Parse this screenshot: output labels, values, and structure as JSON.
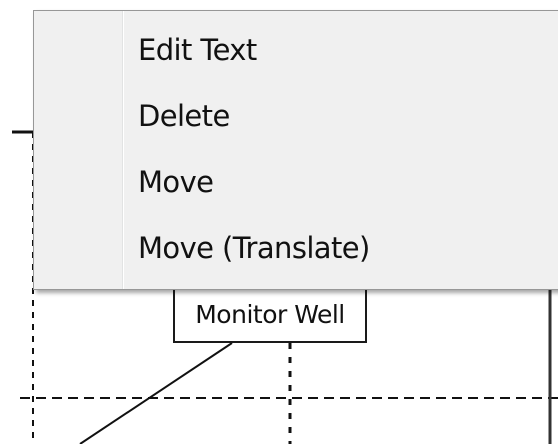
{
  "context_menu": {
    "items": [
      {
        "label": "Edit Text"
      },
      {
        "label": "Delete"
      },
      {
        "label": "Move"
      },
      {
        "label": "Move (Translate)"
      }
    ]
  },
  "map": {
    "callout_label": "Monitor Well"
  },
  "colors": {
    "menu_background": "#f0f0f0",
    "menu_border": "#979797",
    "gutter_separator": "#e2e3e3",
    "text": "#111111",
    "canvas": "#ffffff"
  }
}
